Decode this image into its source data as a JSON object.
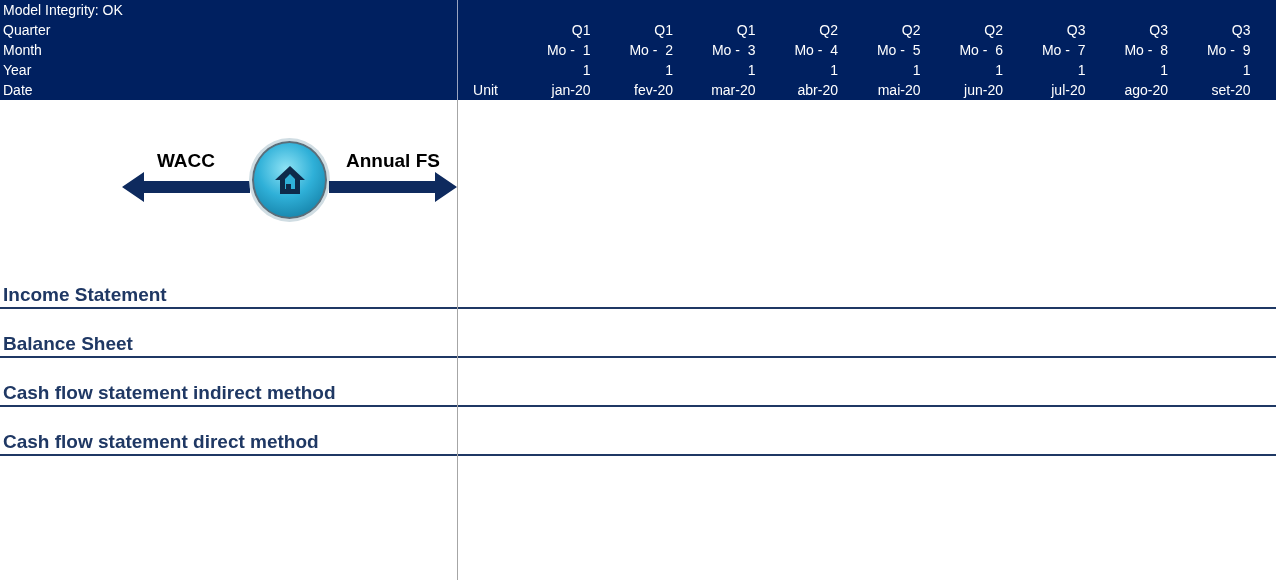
{
  "header": {
    "integrity": "Model Integrity: OK",
    "rows": [
      {
        "label": "Quarter",
        "values": [
          "Q1",
          "Q1",
          "Q1",
          "Q2",
          "Q2",
          "Q2",
          "Q3",
          "Q3",
          "Q3"
        ]
      },
      {
        "label": "Month",
        "values": [
          "Mo -  1",
          "Mo -  2",
          "Mo -  3",
          "Mo -  4",
          "Mo -  5",
          "Mo -  6",
          "Mo -  7",
          "Mo -  8",
          "Mo -  9"
        ]
      },
      {
        "label": "Year",
        "values": [
          "1",
          "1",
          "1",
          "1",
          "1",
          "1",
          "1",
          "1",
          "1"
        ]
      },
      {
        "label": "Date",
        "unit": "Unit",
        "values": [
          "jan-20",
          "fev-20",
          "mar-20",
          "abr-20",
          "mai-20",
          "jun-20",
          "jul-20",
          "ago-20",
          "set-20"
        ]
      }
    ]
  },
  "navigation": {
    "back_label": "WACC",
    "forward_label": "Annual FS"
  },
  "sections": [
    "Income Statement",
    "Balance Sheet",
    "Cash flow statement indirect method",
    "Cash flow statement direct method"
  ]
}
